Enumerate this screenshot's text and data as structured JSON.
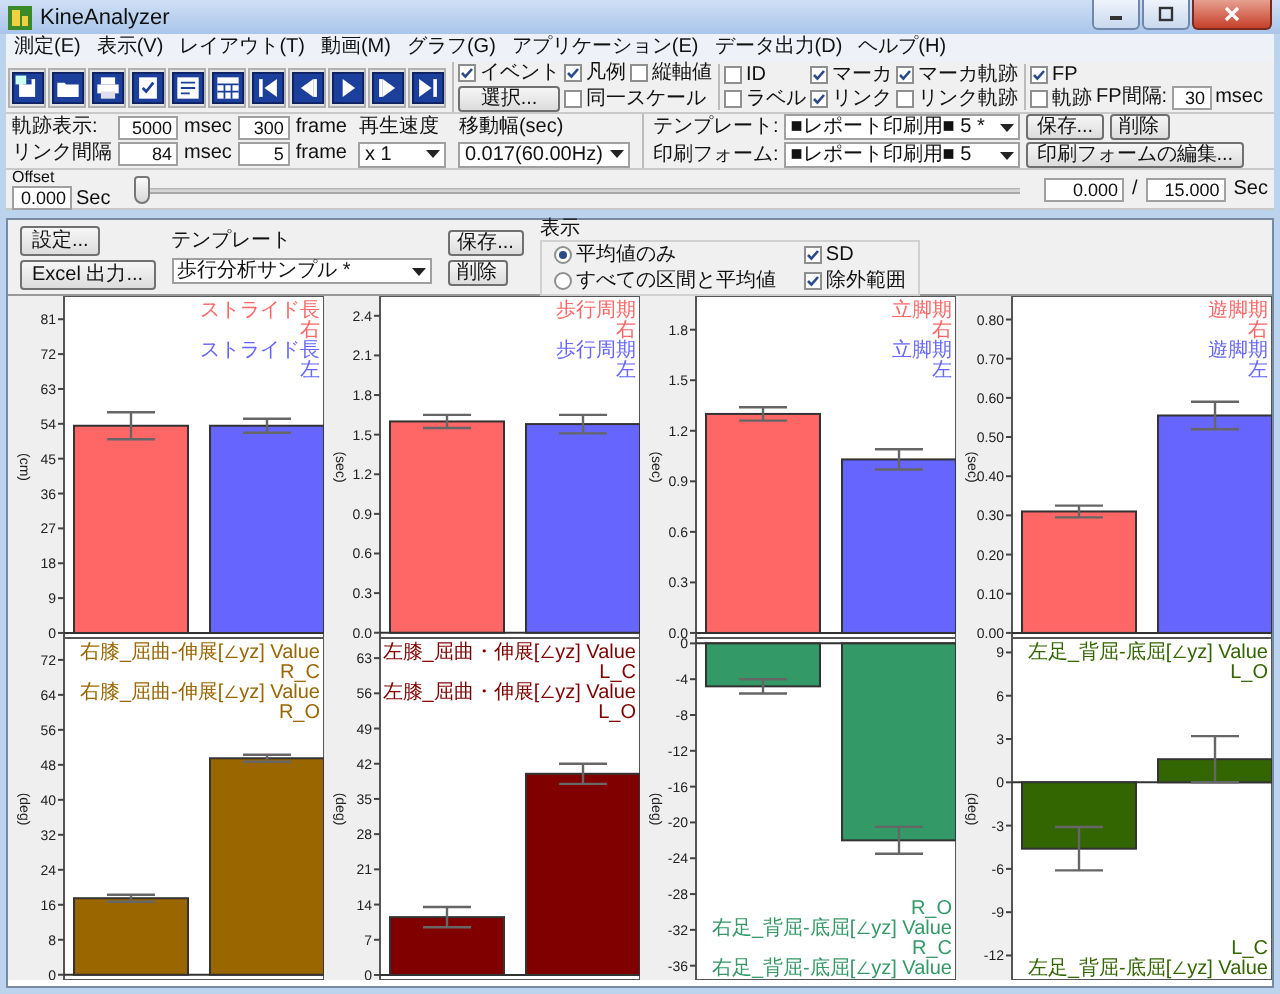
{
  "window": {
    "title": "KineAnalyzer"
  },
  "menu": [
    "測定(E)",
    "表示(V)",
    "レイアウト(T)",
    "動画(M)",
    "グラフ(G)",
    "アプリケーション(E)",
    "データ出力(D)",
    "ヘルプ(H)"
  ],
  "toolbar": {
    "checks_a": [
      {
        "label": "イベント",
        "checked": true
      },
      {
        "label": "凡例",
        "checked": true
      },
      {
        "label": "縦軸値",
        "checked": false
      }
    ],
    "select_button": "選択...",
    "same_scale": {
      "label": "同一スケール",
      "checked": false
    },
    "checks_b": [
      {
        "label": "ID",
        "checked": false
      },
      {
        "label": "マーカ",
        "checked": true
      },
      {
        "label": "マーカ軌跡",
        "checked": true
      },
      {
        "label": "ラベル",
        "checked": false
      },
      {
        "label": "リンク",
        "checked": true
      },
      {
        "label": "リンク軌跡",
        "checked": false
      }
    ],
    "trail": [
      {
        "label": "軌跡表示:",
        "msec": "5000",
        "msec_unit": "msec",
        "frames": "300",
        "frame_unit": "frame"
      },
      {
        "label": "リンク間隔",
        "msec": "84",
        "msec_unit": "msec",
        "frames": "5",
        "frame_unit": "frame"
      }
    ],
    "fp": {
      "label": "FP",
      "checked": true
    },
    "fp_trail": {
      "label": "軌跡",
      "checked": false
    },
    "fp_interval": {
      "label": "FP間隔:",
      "value": "30",
      "unit": "msec"
    }
  },
  "playback": {
    "speed_label": "再生速度",
    "speed": "x 1",
    "step_label": "移動幅(sec)",
    "step": "0.017(60.00Hz)"
  },
  "template_bar": {
    "template_label": "テンプレート:",
    "template": "■レポート印刷用■ 5 *",
    "save": "保存...",
    "delete": "削除",
    "form_label": "印刷フォーム:",
    "form": "■レポート印刷用■ 5",
    "edit_form": "印刷フォームの編集..."
  },
  "offset": {
    "label": "Offset",
    "value": "0.000",
    "unit": "Sec",
    "level": 0,
    "current": "0.000",
    "separator": "/",
    "total": "15.000",
    "total_unit": "Sec"
  },
  "settings": {
    "settings_button": "設定...",
    "excel_button": "Excel 出力...",
    "template_label": "テンプレート",
    "template": "歩行分析サンプル *",
    "save": "保存...",
    "delete": "削除",
    "display_label": "表示",
    "radios": [
      {
        "label": "平均値のみ",
        "selected": true
      },
      {
        "label": "すべての区間と平均値",
        "selected": false
      }
    ],
    "checks": [
      {
        "label": "SD",
        "checked": true
      },
      {
        "label": "除外範囲",
        "checked": true
      }
    ]
  },
  "charts": [
    {
      "legend_top": [
        {
          "text": "ストライド長",
          "color": "#ff6666"
        },
        {
          "text": "右",
          "color": "#ff6666"
        },
        {
          "text": "ストライド長",
          "color": "#6666ff"
        },
        {
          "text": "左",
          "color": "#6666ff"
        }
      ],
      "chart_data": {
        "type": "bar",
        "ylabel": "(cm)",
        "categories": [
          null,
          null
        ],
        "ylim": [
          -1.3,
          87
        ],
        "yticks": [
          0,
          9,
          18,
          27,
          36,
          45,
          54,
          63,
          72,
          81
        ],
        "series": [
          {
            "color": "#ff6666",
            "values": [
              53.5,
              null
            ],
            "errors": [
              3.5,
              null
            ]
          },
          {
            "color": "#6666ff",
            "values": [
              null,
              53.5
            ],
            "errors": [
              null,
              1.8
            ]
          }
        ]
      }
    },
    {
      "legend_top": [
        {
          "text": "歩行周期",
          "color": "#ff6666"
        },
        {
          "text": "右",
          "color": "#ff6666"
        },
        {
          "text": "歩行周期",
          "color": "#6666ff"
        },
        {
          "text": "左",
          "color": "#6666ff"
        }
      ],
      "chart_data": {
        "type": "bar",
        "ylabel": "(sec)",
        "categories": [
          null,
          null
        ],
        "ylim": [
          -0.04,
          2.55
        ],
        "yticks": [
          {
            "value": 0,
            "label": "0.0"
          },
          {
            "value": 0.3,
            "label": "0.3"
          },
          {
            "value": 0.6,
            "label": "0.6"
          },
          {
            "value": 0.9,
            "label": "0.9"
          },
          {
            "value": 1.2,
            "label": "1.2"
          },
          {
            "value": 1.5,
            "label": "1.5"
          },
          {
            "value": 1.8,
            "label": "1.8"
          },
          {
            "value": 2.1,
            "label": "2.1"
          },
          {
            "value": 2.4,
            "label": "2.4"
          }
        ],
        "series": [
          {
            "color": "#ff6666",
            "values": [
              1.6,
              null
            ],
            "errors": [
              0.05,
              null
            ]
          },
          {
            "color": "#6666ff",
            "values": [
              null,
              1.58
            ],
            "errors": [
              null,
              0.07
            ]
          }
        ]
      }
    },
    {
      "legend_top": [
        {
          "text": "立脚期",
          "color": "#ff6666"
        },
        {
          "text": "右",
          "color": "#ff6666"
        },
        {
          "text": "立脚期",
          "color": "#6666ff"
        },
        {
          "text": "左",
          "color": "#6666ff"
        }
      ],
      "chart_data": {
        "type": "bar",
        "ylabel": "(sec)",
        "categories": [
          null,
          null
        ],
        "ylim": [
          -0.03,
          2.0
        ],
        "yticks": [
          {
            "value": 0,
            "label": "0.0"
          },
          {
            "value": 0.3,
            "label": "0.3"
          },
          {
            "value": 0.6,
            "label": "0.6"
          },
          {
            "value": 0.9,
            "label": "0.9"
          },
          {
            "value": 1.2,
            "label": "1.2"
          },
          {
            "value": 1.5,
            "label": "1.5"
          },
          {
            "value": 1.8,
            "label": "1.8"
          }
        ],
        "series": [
          {
            "color": "#ff6666",
            "values": [
              1.3,
              null
            ],
            "errors": [
              0.04,
              null
            ]
          },
          {
            "color": "#6666ff",
            "values": [
              null,
              1.03
            ],
            "errors": [
              null,
              0.06
            ]
          }
        ]
      }
    },
    {
      "legend_top": [
        {
          "text": "遊脚期",
          "color": "#ff6666"
        },
        {
          "text": "右",
          "color": "#ff6666"
        },
        {
          "text": "遊脚期",
          "color": "#6666ff"
        },
        {
          "text": "左",
          "color": "#6666ff"
        }
      ],
      "chart_data": {
        "type": "bar",
        "ylabel": "(sec)",
        "categories": [
          null,
          null
        ],
        "ylim": [
          -0.013,
          0.86
        ],
        "yticks": [
          {
            "value": 0,
            "label": "0.00"
          },
          {
            "value": 0.1,
            "label": "0.10"
          },
          {
            "value": 0.2,
            "label": "0.20"
          },
          {
            "value": 0.3,
            "label": "0.30"
          },
          {
            "value": 0.4,
            "label": "0.40"
          },
          {
            "value": 0.5,
            "label": "0.50"
          },
          {
            "value": 0.6,
            "label": "0.60"
          },
          {
            "value": 0.7,
            "label": "0.70"
          },
          {
            "value": 0.8,
            "label": "0.80"
          }
        ],
        "series": [
          {
            "color": "#ff6666",
            "values": [
              0.31,
              null
            ],
            "errors": [
              0.015,
              null
            ]
          },
          {
            "color": "#6666ff",
            "values": [
              null,
              0.555
            ],
            "errors": [
              null,
              0.035
            ]
          }
        ]
      }
    },
    {
      "legend_top": [
        {
          "text": "右膝_屈曲-伸展[∠yz] Value",
          "color": "#996600"
        },
        {
          "text": "R_C",
          "color": "#996600"
        },
        {
          "text": "右膝_屈曲-伸展[∠yz] Value",
          "color": "#996600"
        },
        {
          "text": "R_O",
          "color": "#996600"
        }
      ],
      "chart_data": {
        "type": "bar",
        "ylabel": "(deg)",
        "categories": [
          null,
          null
        ],
        "ylim": [
          -1.2,
          77
        ],
        "yticks": [
          0,
          8,
          16,
          24,
          32,
          40,
          48,
          56,
          64,
          72
        ],
        "series": [
          {
            "color": "#996600",
            "values": [
              17.5,
              49.5
            ],
            "errors": [
              0.8,
              0.8
            ]
          }
        ]
      }
    },
    {
      "legend_top": [
        {
          "text": "左膝_屈曲・伸展[∠yz] Value",
          "color": "#800000"
        },
        {
          "text": "L_C",
          "color": "#800000"
        },
        {
          "text": "左膝_屈曲・伸展[∠yz] Value",
          "color": "#800000"
        },
        {
          "text": "L_O",
          "color": "#800000"
        }
      ],
      "chart_data": {
        "type": "bar",
        "ylabel": "(deg)",
        "categories": [
          null,
          null
        ],
        "ylim": [
          -1,
          67
        ],
        "yticks": [
          0,
          7,
          14,
          21,
          28,
          35,
          42,
          49,
          56,
          63
        ],
        "series": [
          {
            "color": "#800000",
            "values": [
              11.5,
              40
            ],
            "errors": [
              2,
              2
            ]
          }
        ]
      }
    },
    {
      "legend_bottom": [
        {
          "text": "R_O",
          "color": "#339966"
        },
        {
          "text": "右足_背屈-底屈[∠yz] Value",
          "color": "#339966"
        },
        {
          "text": "R_C",
          "color": "#339966"
        },
        {
          "text": "右足_背屈-底屈[∠yz] Value",
          "color": "#339966"
        }
      ],
      "chart_data": {
        "type": "bar",
        "ylabel": "(deg)",
        "categories": [
          null,
          null
        ],
        "ylim": [
          -37.6,
          0.6
        ],
        "yticks": [
          0,
          -4,
          -8,
          -12,
          -16,
          -20,
          -24,
          -28,
          -32,
          -36
        ],
        "series": [
          {
            "color": "#339966",
            "values": [
              -4.8,
              -22
            ],
            "errors": [
              0.8,
              1.5
            ]
          }
        ]
      }
    },
    {
      "legend_top": [
        {
          "text": "左足_背屈-底屈[∠yz] Value",
          "color": "#336600"
        },
        {
          "text": "L_O",
          "color": "#336600"
        }
      ],
      "legend_bottom": [
        {
          "text": "L_C",
          "color": "#336600"
        },
        {
          "text": "左足_背屈-底屈[∠yz] Value",
          "color": "#336600"
        }
      ],
      "chart_data": {
        "type": "bar",
        "ylabel": "(deg)",
        "categories": [
          null,
          null
        ],
        "ylim": [
          -13.7,
          10
        ],
        "yticks": [
          9,
          6,
          3,
          0,
          -3,
          -6,
          -9,
          -12
        ],
        "series": [
          {
            "color": "#336600",
            "values": [
              -4.6,
              1.6
            ],
            "errors": [
              1.5,
              1.6
            ]
          }
        ]
      }
    }
  ]
}
